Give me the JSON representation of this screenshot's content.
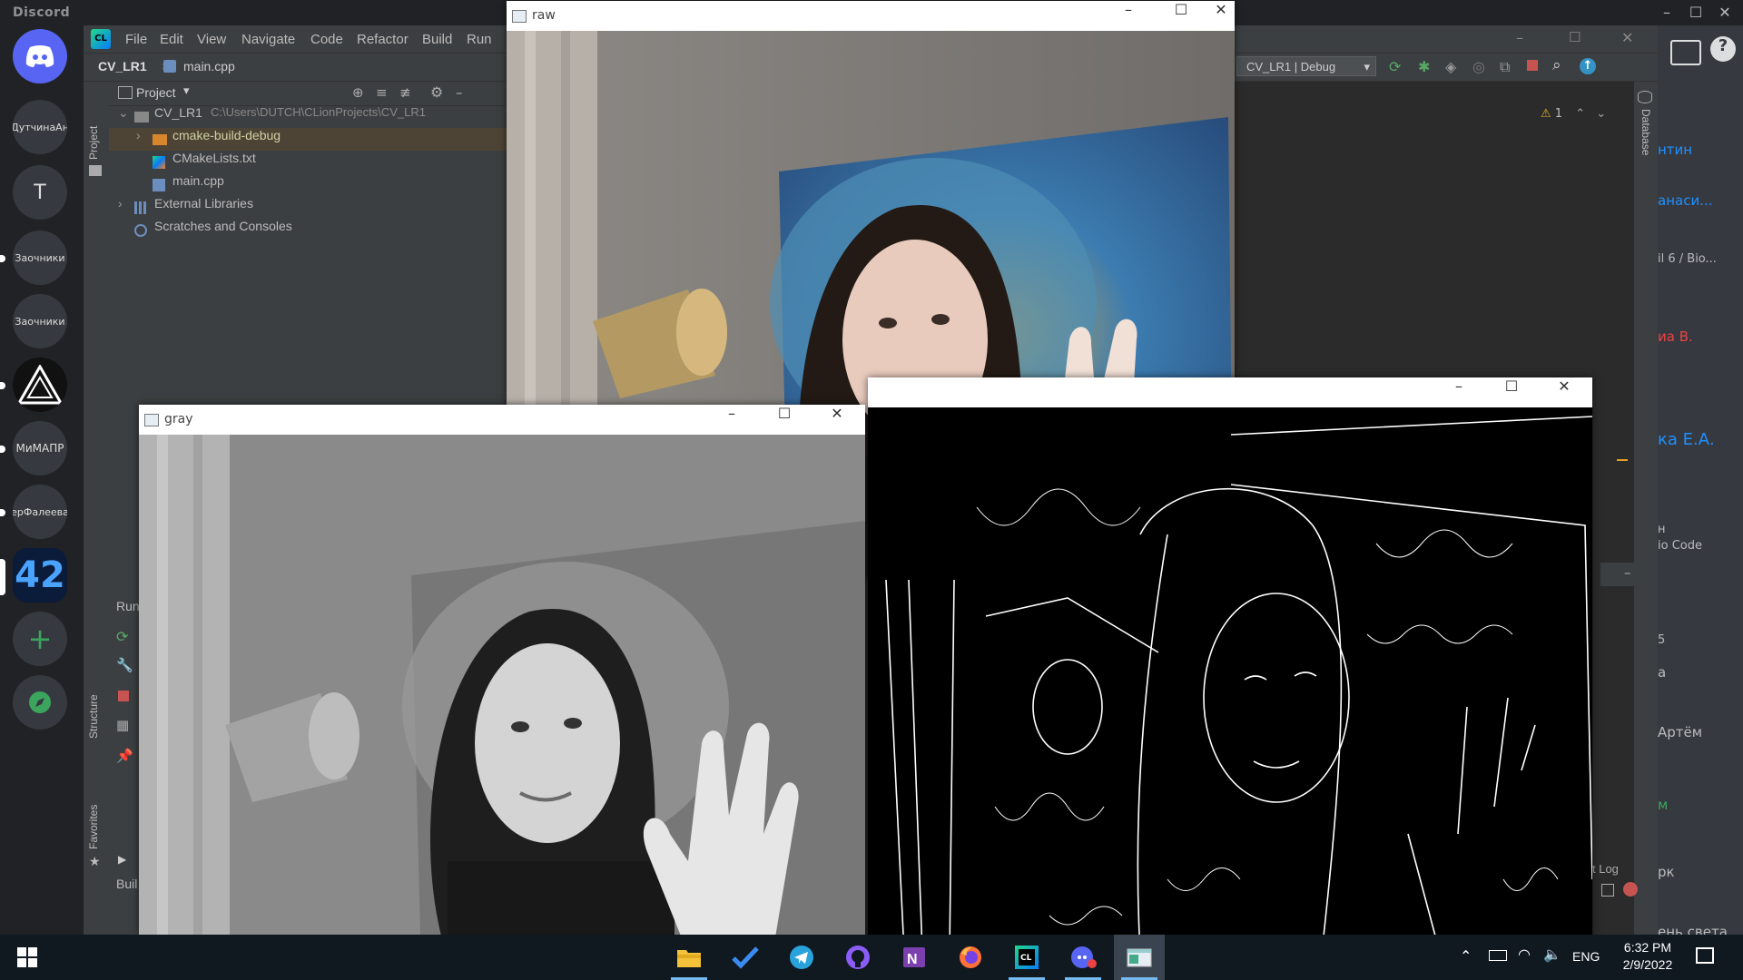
{
  "discord": {
    "app_name": "Discord",
    "servers": [
      {
        "label": "ДутчинаАн"
      },
      {
        "label": "T"
      },
      {
        "label": "Заочники"
      },
      {
        "label": "Заочники"
      },
      {
        "label": ""
      },
      {
        "label": "МиМАПР"
      },
      {
        "label": "ерФалеева"
      },
      {
        "label": "42"
      }
    ],
    "right_snippets": [
      "нтин",
      "анаси...",
      "il 6 / Bio...",
      "иа В.",
      "ка Е.А.",
      "н",
      "io Code",
      "5",
      "а",
      "Артём",
      "м",
      "рк",
      "ень света"
    ]
  },
  "clion": {
    "menu": [
      "File",
      "Edit",
      "View",
      "Navigate",
      "Code",
      "Refactor",
      "Build",
      "Run"
    ],
    "breadcrumb": {
      "project": "CV_LR1",
      "file": "main.cpp"
    },
    "run_config": "CV_LR1 | Debug",
    "panel": {
      "title": "Project",
      "tree": [
        {
          "label": "CV_LR1",
          "hint": "C:\\Users\\DUTCH\\CLionProjects\\CV_LR1"
        },
        {
          "label": "cmake-build-debug"
        },
        {
          "label": "CMakeLists.txt"
        },
        {
          "label": "main.cpp"
        },
        {
          "label": "External Libraries"
        },
        {
          "label": "Scratches and Consoles"
        }
      ]
    },
    "left_tabs": {
      "project": "Project",
      "structure": "Structure",
      "favorites": "Favorites"
    },
    "right_tabs": {
      "database": "Database"
    },
    "warning_count": "1",
    "run_tab": "Run",
    "build_tab": "Buil",
    "event_log": "t Log"
  },
  "windows": {
    "raw_title": "raw",
    "gray_title": "gray"
  },
  "taskbar": {
    "language": "ENG",
    "time": "6:32 PM",
    "date": "2/9/2022"
  }
}
